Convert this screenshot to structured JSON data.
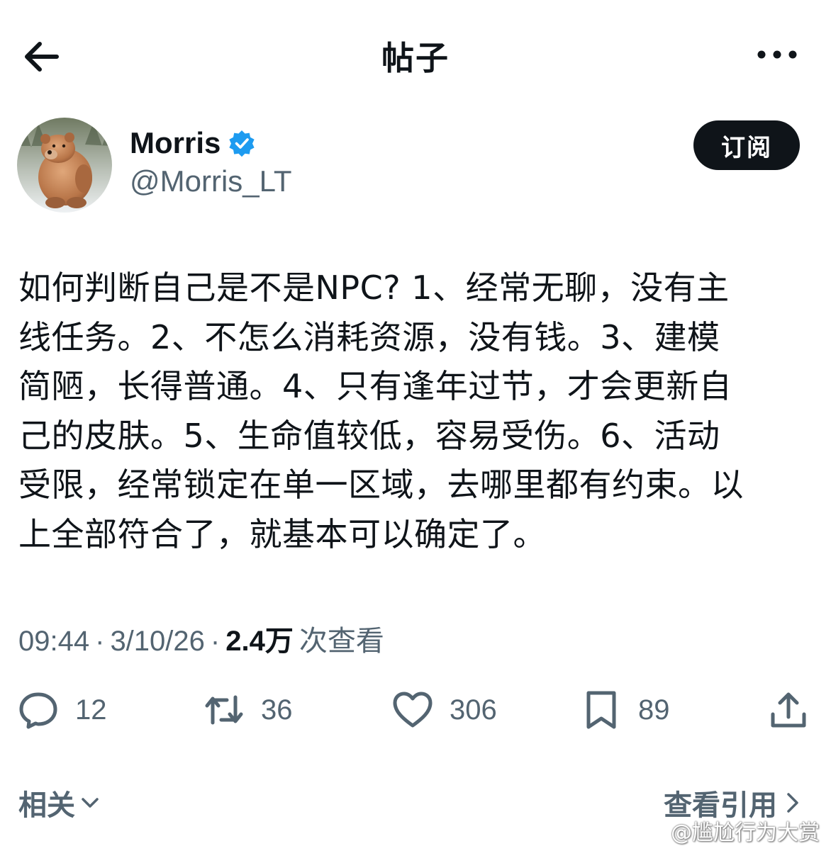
{
  "header": {
    "title": "帖子",
    "back_icon": "arrow-left-icon",
    "more_icon": "more-horizontal-icon"
  },
  "author": {
    "name": "Morris",
    "handle": "@Morris_LT",
    "verified_color": "#1d9bf0",
    "subscribe_label": "订阅"
  },
  "post": {
    "lines": [
      "如何判断自己是不是NPC? 1、经常无聊，没有主",
      "线任务。2、不怎么消耗资源，没有钱。3、建模",
      "简陋，长得普通。4、只有逢年过节，才会更新自",
      "己的皮肤。5、生命值较低，容易受伤。6、活动",
      "受限，经常锁定在单一区域，去哪里都有约束。以",
      "上全部符合了，就基本可以确定了。"
    ]
  },
  "meta": {
    "time": "09:44",
    "date": "3/10/26",
    "views_count": "2.4万",
    "views_label": "次查看",
    "separator": "·"
  },
  "actions": {
    "reply_count": "12",
    "retweet_count": "36",
    "like_count": "306",
    "bookmark_count": "89"
  },
  "footer": {
    "related_label": "相关",
    "quotes_label": "查看引用"
  },
  "watermark": "@尴尬行为大赏"
}
